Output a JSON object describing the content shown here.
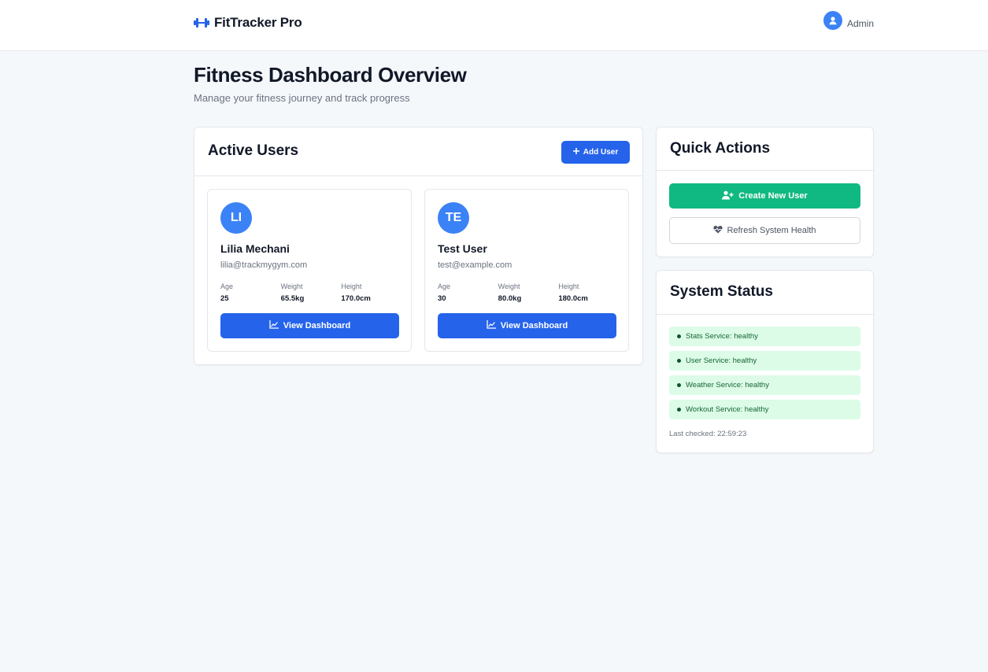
{
  "header": {
    "brand": "FitTracker Pro",
    "brand_icon": "dumbbell-icon",
    "user_label": "Admin",
    "user_icon": "user-circle-icon"
  },
  "page": {
    "title": "Fitness Dashboard Overview",
    "subtitle": "Manage your fitness journey and track progress"
  },
  "active_users": {
    "title": "Active Users",
    "add_button": "Add User",
    "users": [
      {
        "initials": "LI",
        "name": "Lilia Mechani",
        "email": "lilia@trackmygym.com",
        "age_label": "Age",
        "age": "25",
        "weight_label": "Weight",
        "weight": "65.5kg",
        "height_label": "Height",
        "height": "170.0cm",
        "button": "View Dashboard"
      },
      {
        "initials": "TE",
        "name": "Test User",
        "email": "test@example.com",
        "age_label": "Age",
        "age": "30",
        "weight_label": "Weight",
        "weight": "80.0kg",
        "height_label": "Height",
        "height": "180.0cm",
        "button": "View Dashboard"
      }
    ]
  },
  "quick_actions": {
    "title": "Quick Actions",
    "create_button": "Create New User",
    "refresh_button": "Refresh System Health"
  },
  "system_status": {
    "title": "System Status",
    "services": [
      "Stats Service: healthy",
      "User Service: healthy",
      "Weather Service: healthy",
      "Workout Service: healthy"
    ],
    "last_checked": "Last checked: 22:59:23"
  },
  "colors": {
    "primary": "#2563eb",
    "success": "#10b981",
    "status_bg": "#dcfce7",
    "status_text": "#166534",
    "page_bg": "#f5f8fb"
  }
}
